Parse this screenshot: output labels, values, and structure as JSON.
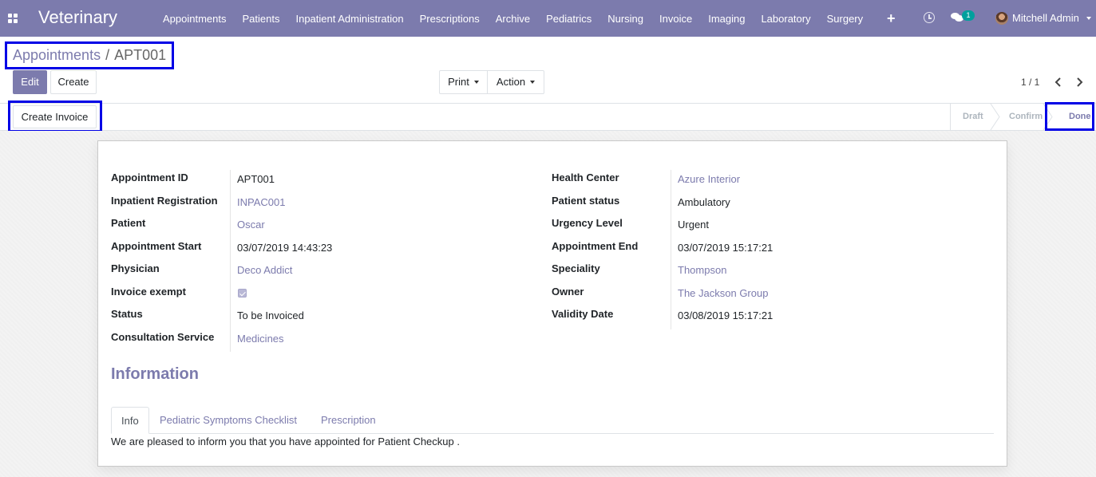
{
  "app": {
    "title": "Veterinary"
  },
  "nav": {
    "items": [
      "Appointments",
      "Patients",
      "Inpatient Administration",
      "Prescriptions",
      "Archive",
      "Pediatrics",
      "Nursing",
      "Invoice",
      "Imaging",
      "Laboratory",
      "Surgery"
    ],
    "chat_count": "1",
    "user": "Mitchell Admin",
    "icons": [
      "apps-icon",
      "plus-icon",
      "clock-icon",
      "chat-icon"
    ]
  },
  "breadcrumb": {
    "parent": "Appointments",
    "separator": "/",
    "current": "APT001"
  },
  "buttons": {
    "edit": "Edit",
    "create": "Create",
    "print": "Print",
    "action": "Action",
    "create_invoice": "Create Invoice"
  },
  "pager": {
    "value": "1 / 1"
  },
  "statusbar": {
    "stages": [
      "Draft",
      "Confirm",
      "Done"
    ],
    "active": "Done"
  },
  "form": {
    "left": [
      {
        "label": "Appointment ID",
        "value": "APT001",
        "link": false
      },
      {
        "label": "Inpatient Registration",
        "value": "INPAC001",
        "link": true
      },
      {
        "label": "Patient",
        "value": "Oscar",
        "link": true
      },
      {
        "label": "Appointment Start",
        "value": "03/07/2019 14:43:23",
        "link": false
      },
      {
        "label": "Physician",
        "value": "Deco Addict",
        "link": true
      },
      {
        "label": "Invoice exempt",
        "value": "checked",
        "link": false
      },
      {
        "label": "Status",
        "value": "To be Invoiced",
        "link": false
      },
      {
        "label": "Consultation Service",
        "value": "Medicines",
        "link": true
      }
    ],
    "right": [
      {
        "label": "Health Center",
        "value": "Azure Interior",
        "link": true
      },
      {
        "label": "Patient status",
        "value": "Ambulatory",
        "link": false
      },
      {
        "label": "Urgency Level",
        "value": "Urgent",
        "link": false
      },
      {
        "label": "Appointment End",
        "value": "03/07/2019 15:17:21",
        "link": false
      },
      {
        "label": "Speciality",
        "value": "Thompson",
        "link": true
      },
      {
        "label": "Owner",
        "value": "The Jackson Group",
        "link": true
      },
      {
        "label": "Validity Date",
        "value": "03/08/2019 15:17:21",
        "link": false
      }
    ]
  },
  "information": {
    "title": "Information",
    "tabs": [
      "Info",
      "Pediatric Symptoms Checklist",
      "Prescription"
    ],
    "active_tab": "Info",
    "info_text": "We are pleased to inform you that you have appointed for Patient Checkup ."
  },
  "colors": {
    "brand": "#7c7bad",
    "highlight": "#0000e6"
  }
}
